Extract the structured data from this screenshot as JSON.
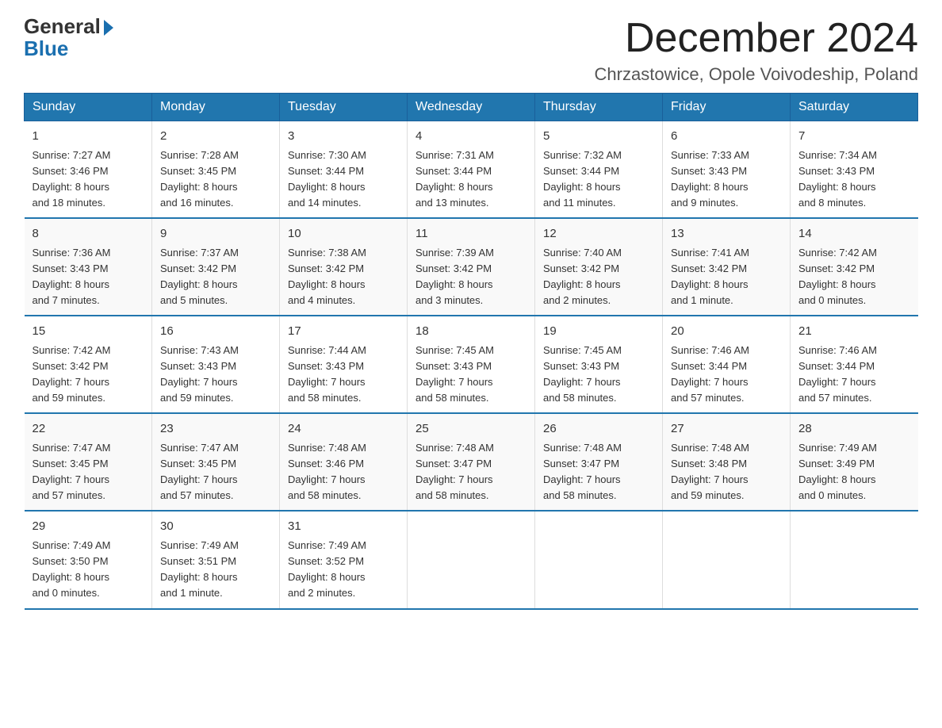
{
  "logo": {
    "part1": "General",
    "part2": "Blue"
  },
  "title": "December 2024",
  "location": "Chrzastowice, Opole Voivodeship, Poland",
  "days_of_week": [
    "Sunday",
    "Monday",
    "Tuesday",
    "Wednesday",
    "Thursday",
    "Friday",
    "Saturday"
  ],
  "weeks": [
    [
      {
        "day": "1",
        "info": "Sunrise: 7:27 AM\nSunset: 3:46 PM\nDaylight: 8 hours\nand 18 minutes."
      },
      {
        "day": "2",
        "info": "Sunrise: 7:28 AM\nSunset: 3:45 PM\nDaylight: 8 hours\nand 16 minutes."
      },
      {
        "day": "3",
        "info": "Sunrise: 7:30 AM\nSunset: 3:44 PM\nDaylight: 8 hours\nand 14 minutes."
      },
      {
        "day": "4",
        "info": "Sunrise: 7:31 AM\nSunset: 3:44 PM\nDaylight: 8 hours\nand 13 minutes."
      },
      {
        "day": "5",
        "info": "Sunrise: 7:32 AM\nSunset: 3:44 PM\nDaylight: 8 hours\nand 11 minutes."
      },
      {
        "day": "6",
        "info": "Sunrise: 7:33 AM\nSunset: 3:43 PM\nDaylight: 8 hours\nand 9 minutes."
      },
      {
        "day": "7",
        "info": "Sunrise: 7:34 AM\nSunset: 3:43 PM\nDaylight: 8 hours\nand 8 minutes."
      }
    ],
    [
      {
        "day": "8",
        "info": "Sunrise: 7:36 AM\nSunset: 3:43 PM\nDaylight: 8 hours\nand 7 minutes."
      },
      {
        "day": "9",
        "info": "Sunrise: 7:37 AM\nSunset: 3:42 PM\nDaylight: 8 hours\nand 5 minutes."
      },
      {
        "day": "10",
        "info": "Sunrise: 7:38 AM\nSunset: 3:42 PM\nDaylight: 8 hours\nand 4 minutes."
      },
      {
        "day": "11",
        "info": "Sunrise: 7:39 AM\nSunset: 3:42 PM\nDaylight: 8 hours\nand 3 minutes."
      },
      {
        "day": "12",
        "info": "Sunrise: 7:40 AM\nSunset: 3:42 PM\nDaylight: 8 hours\nand 2 minutes."
      },
      {
        "day": "13",
        "info": "Sunrise: 7:41 AM\nSunset: 3:42 PM\nDaylight: 8 hours\nand 1 minute."
      },
      {
        "day": "14",
        "info": "Sunrise: 7:42 AM\nSunset: 3:42 PM\nDaylight: 8 hours\nand 0 minutes."
      }
    ],
    [
      {
        "day": "15",
        "info": "Sunrise: 7:42 AM\nSunset: 3:42 PM\nDaylight: 7 hours\nand 59 minutes."
      },
      {
        "day": "16",
        "info": "Sunrise: 7:43 AM\nSunset: 3:43 PM\nDaylight: 7 hours\nand 59 minutes."
      },
      {
        "day": "17",
        "info": "Sunrise: 7:44 AM\nSunset: 3:43 PM\nDaylight: 7 hours\nand 58 minutes."
      },
      {
        "day": "18",
        "info": "Sunrise: 7:45 AM\nSunset: 3:43 PM\nDaylight: 7 hours\nand 58 minutes."
      },
      {
        "day": "19",
        "info": "Sunrise: 7:45 AM\nSunset: 3:43 PM\nDaylight: 7 hours\nand 58 minutes."
      },
      {
        "day": "20",
        "info": "Sunrise: 7:46 AM\nSunset: 3:44 PM\nDaylight: 7 hours\nand 57 minutes."
      },
      {
        "day": "21",
        "info": "Sunrise: 7:46 AM\nSunset: 3:44 PM\nDaylight: 7 hours\nand 57 minutes."
      }
    ],
    [
      {
        "day": "22",
        "info": "Sunrise: 7:47 AM\nSunset: 3:45 PM\nDaylight: 7 hours\nand 57 minutes."
      },
      {
        "day": "23",
        "info": "Sunrise: 7:47 AM\nSunset: 3:45 PM\nDaylight: 7 hours\nand 57 minutes."
      },
      {
        "day": "24",
        "info": "Sunrise: 7:48 AM\nSunset: 3:46 PM\nDaylight: 7 hours\nand 58 minutes."
      },
      {
        "day": "25",
        "info": "Sunrise: 7:48 AM\nSunset: 3:47 PM\nDaylight: 7 hours\nand 58 minutes."
      },
      {
        "day": "26",
        "info": "Sunrise: 7:48 AM\nSunset: 3:47 PM\nDaylight: 7 hours\nand 58 minutes."
      },
      {
        "day": "27",
        "info": "Sunrise: 7:48 AM\nSunset: 3:48 PM\nDaylight: 7 hours\nand 59 minutes."
      },
      {
        "day": "28",
        "info": "Sunrise: 7:49 AM\nSunset: 3:49 PM\nDaylight: 8 hours\nand 0 minutes."
      }
    ],
    [
      {
        "day": "29",
        "info": "Sunrise: 7:49 AM\nSunset: 3:50 PM\nDaylight: 8 hours\nand 0 minutes."
      },
      {
        "day": "30",
        "info": "Sunrise: 7:49 AM\nSunset: 3:51 PM\nDaylight: 8 hours\nand 1 minute."
      },
      {
        "day": "31",
        "info": "Sunrise: 7:49 AM\nSunset: 3:52 PM\nDaylight: 8 hours\nand 2 minutes."
      },
      {
        "day": "",
        "info": ""
      },
      {
        "day": "",
        "info": ""
      },
      {
        "day": "",
        "info": ""
      },
      {
        "day": "",
        "info": ""
      }
    ]
  ]
}
